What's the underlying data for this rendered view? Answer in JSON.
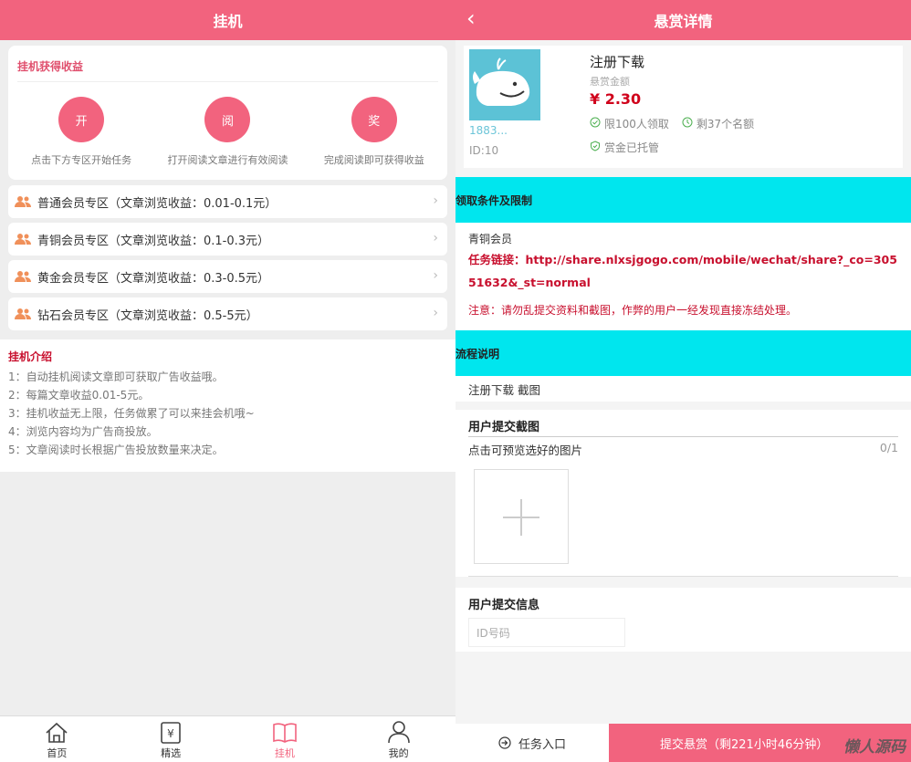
{
  "left": {
    "header_title": "挂机",
    "earn": {
      "title": "挂机获得收益",
      "steps": [
        {
          "icon_text": "开",
          "text": "点击下方专区开始任务"
        },
        {
          "icon_text": "阅",
          "text": "打开阅读文章进行有效阅读"
        },
        {
          "icon_text": "奖",
          "text": "完成阅读即可获得收益"
        }
      ]
    },
    "zones": [
      "普通会员专区（文章浏览收益：0.01-0.1元）",
      "青铜会员专区（文章浏览收益：0.1-0.3元）",
      "黄金会员专区（文章浏览收益：0.3-0.5元）",
      "钻石会员专区（文章浏览收益：0.5-5元）"
    ],
    "intro": {
      "title": "挂机介绍",
      "lines": [
        "1：自动挂机阅读文章即可获取广告收益哦。",
        "2：每篇文章收益0.01-5元。",
        "3：挂机收益无上限，任务做累了可以来挂会机哦~",
        "4：浏览内容均为广告商投放。",
        "5：文章阅读时长根据广告投放数量来决定。"
      ]
    },
    "tabs": [
      {
        "label": "首页",
        "icon": "home-icon"
      },
      {
        "label": "精选",
        "icon": "yen-icon"
      },
      {
        "label": "挂机",
        "icon": "book-icon"
      },
      {
        "label": "我的",
        "icon": "user-icon"
      }
    ],
    "tab_currency": "¥",
    "colors": {
      "accent": "#f2637e",
      "cyan": "#00e6ee",
      "red": "#c8102e"
    }
  },
  "right": {
    "header_title": "悬赏详情",
    "back_icon": "‹",
    "task": {
      "title": "注册下载",
      "reward_label": "悬赏金额",
      "price": "¥ 2.30",
      "limit": "限100人领取",
      "remaining": "剩37个名额",
      "escrow": "赏金已托管",
      "user_name": "1883...",
      "user_id": "ID:10"
    },
    "conditions": {
      "heading": "领取条件及限制",
      "level": "青铜会员",
      "link_prefix": "任务链接：",
      "link": "http://share.nlxsjgogo.com/mobile/wechat/share?_co=30551632&_st=normal",
      "warning": "注意：请勿乱提交资料和截图，作弊的用户一经发现直接冻结处理。"
    },
    "process": {
      "heading": "流程说明",
      "text": "注册下载 截图"
    },
    "screenshot": {
      "heading": "用户提交截图",
      "hint": "点击可预览选好的图片",
      "count": "0/1"
    },
    "info": {
      "heading": "用户提交信息",
      "placeholder": "ID号码"
    },
    "bottom": {
      "entry_label": "任务入口",
      "submit_label": "提交悬赏（剩221小时46分钟）",
      "watermark": "懒人源码"
    }
  }
}
